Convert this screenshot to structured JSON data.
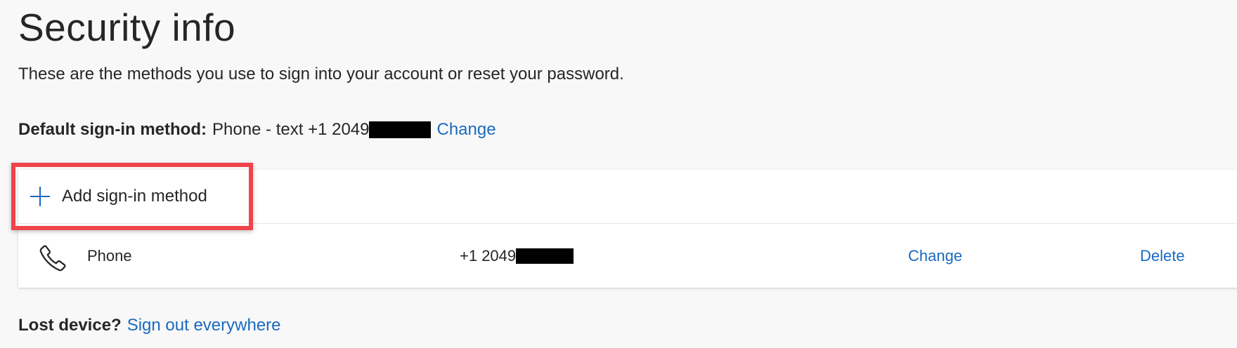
{
  "header": {
    "title": "Security info",
    "subtitle": "These are the methods you use to sign into your account or reset your password."
  },
  "default_method": {
    "label": "Default sign-in method:",
    "value": "Phone - text +1 2049",
    "change_link": "Change"
  },
  "add_method": {
    "label": "Add sign-in method",
    "icon": "plus-icon"
  },
  "methods": [
    {
      "icon": "phone-icon",
      "name": "Phone",
      "value": "+1 2049",
      "change_label": "Change",
      "delete_label": "Delete"
    }
  ],
  "lost_device": {
    "label": "Lost device?",
    "link": "Sign out everywhere"
  },
  "colors": {
    "accent": "#1a6ac0",
    "highlight": "#f0434a",
    "background": "#f8f8f8"
  }
}
